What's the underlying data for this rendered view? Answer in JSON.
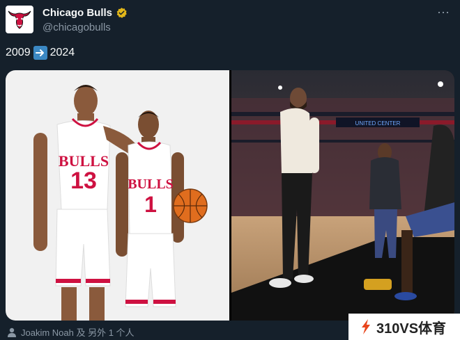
{
  "account": {
    "name": "Chicago Bulls",
    "handle": "@chicagobulls",
    "avatar_icon": "bulls-logo-icon",
    "verified_icon": "verified-badge-icon",
    "more_icon": "more-options-icon"
  },
  "tweet": {
    "year_from": "2009",
    "year_to": "2024",
    "arrow_icon": "right-arrow-emoji-icon"
  },
  "media": {
    "left": {
      "jersey_numbers": [
        "13",
        "1"
      ],
      "jersey_text": "BULLS"
    },
    "right": {
      "scoreboard_text": "UNITED CENTER"
    }
  },
  "tagged": {
    "icon": "person-icon",
    "label": "Joakim Noah 及 另外 1 个人"
  },
  "watermark": {
    "text": "310VS体育"
  },
  "colors": {
    "background": "#15202b",
    "secondary_text": "#8b98a5",
    "verified": "#e2b719",
    "bulls_red": "#ce1141"
  }
}
